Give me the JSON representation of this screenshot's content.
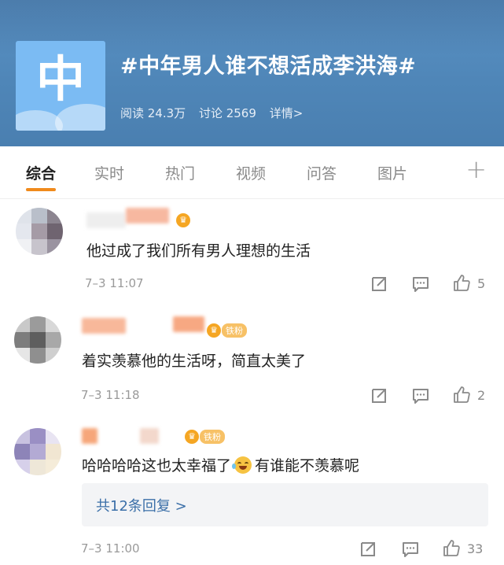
{
  "topic": {
    "logo_char": "中",
    "title": "#中年男人谁不想活成李洪海#",
    "reads": "阅读 24.3万",
    "discussions": "讨论 2569",
    "details": "详情>"
  },
  "tabs": [
    "综合",
    "实时",
    "热门",
    "视频",
    "问答",
    "图片"
  ],
  "tab_plus": "+",
  "colors": {
    "accent": "#f08a1c",
    "header": "#4f86b8",
    "link": "#3b6fa8"
  },
  "comments": [
    {
      "text": "他过成了我们所有男人理想的生活",
      "time": "7–3 11:07",
      "likes": "5",
      "badge": ""
    },
    {
      "text": "着实羡慕他的生活呀，简直太美了",
      "time": "7–3 11:18",
      "likes": "2",
      "badge": "铁粉"
    },
    {
      "text_before": "哈哈哈哈这也太幸福了",
      "emoji": "laughing-tears-emoji",
      "text_after": "有谁能不羡慕呢",
      "time": "7–3 11:00",
      "likes": "33",
      "badge": "铁粉",
      "replies": "共12条回复 >"
    }
  ]
}
